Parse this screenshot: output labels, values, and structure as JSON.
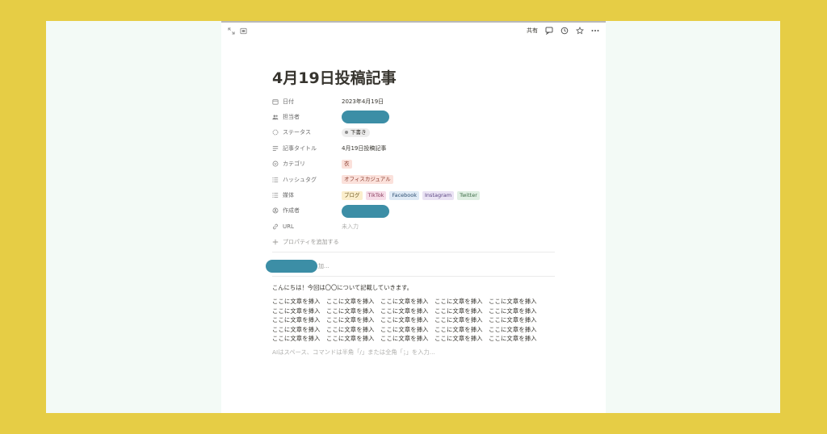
{
  "topbar": {
    "share_label": "共有"
  },
  "page": {
    "title": "4月19日投稿記事"
  },
  "properties": {
    "date": {
      "label": "日付",
      "value": "2023年4月19日"
    },
    "owner": {
      "label": "担当者"
    },
    "status": {
      "label": "ステータス",
      "value": "下書き"
    },
    "article_title": {
      "label": "記事タイトル",
      "value": "4月19日投稿記事"
    },
    "category": {
      "label": "カテゴリ",
      "value": "衣"
    },
    "hashtag": {
      "label": "ハッシュタグ",
      "value": "オフィスカジュアル"
    },
    "media": {
      "label": "媒体",
      "tags": [
        {
          "text": "ブログ",
          "bg": "#fbeecc",
          "fg": "#6f5a22"
        },
        {
          "text": "TikTok",
          "bg": "#f6dde8",
          "fg": "#8a3c5e"
        },
        {
          "text": "Facebook",
          "bg": "#dfeaf5",
          "fg": "#2d4f72"
        },
        {
          "text": "Instagram",
          "bg": "#eae3f4",
          "fg": "#5b4582"
        },
        {
          "text": "Twitter",
          "bg": "#e0efe3",
          "fg": "#3b6b45"
        }
      ]
    },
    "creator": {
      "label": "作成者"
    },
    "url": {
      "label": "URL",
      "placeholder": "未入力"
    },
    "add_property": "プロパティを追加する"
  },
  "comment": {
    "placeholder_tail": "加..."
  },
  "body": {
    "intro": "こんにちは！今回は〇〇について記載していきます。",
    "lines": [
      "ここに文章を挿入　ここに文章を挿入　ここに文章を挿入　ここに文章を挿入　ここに文章を挿入",
      "ここに文章を挿入　ここに文章を挿入　ここに文章を挿入　ここに文章を挿入　ここに文章を挿入",
      "ここに文章を挿入　ここに文章を挿入　ここに文章を挿入　ここに文章を挿入　ここに文章を挿入",
      "ここに文章を挿入　ここに文章を挿入　ここに文章を挿入　ここに文章を挿入　ここに文章を挿入",
      "ここに文章を挿入　ここに文章を挿入　ここに文章を挿入　ここに文章を挿入　ここに文章を挿入"
    ],
    "hint": "AIはスペース、コマンドは半角「/」または全角「；」を入力..."
  },
  "colors": {
    "background": "#e6cd45",
    "redaction": "#3c8ea6",
    "category_tag_bg": "#fbe1db",
    "hashtag_tag_bg": "#fbe1db"
  }
}
